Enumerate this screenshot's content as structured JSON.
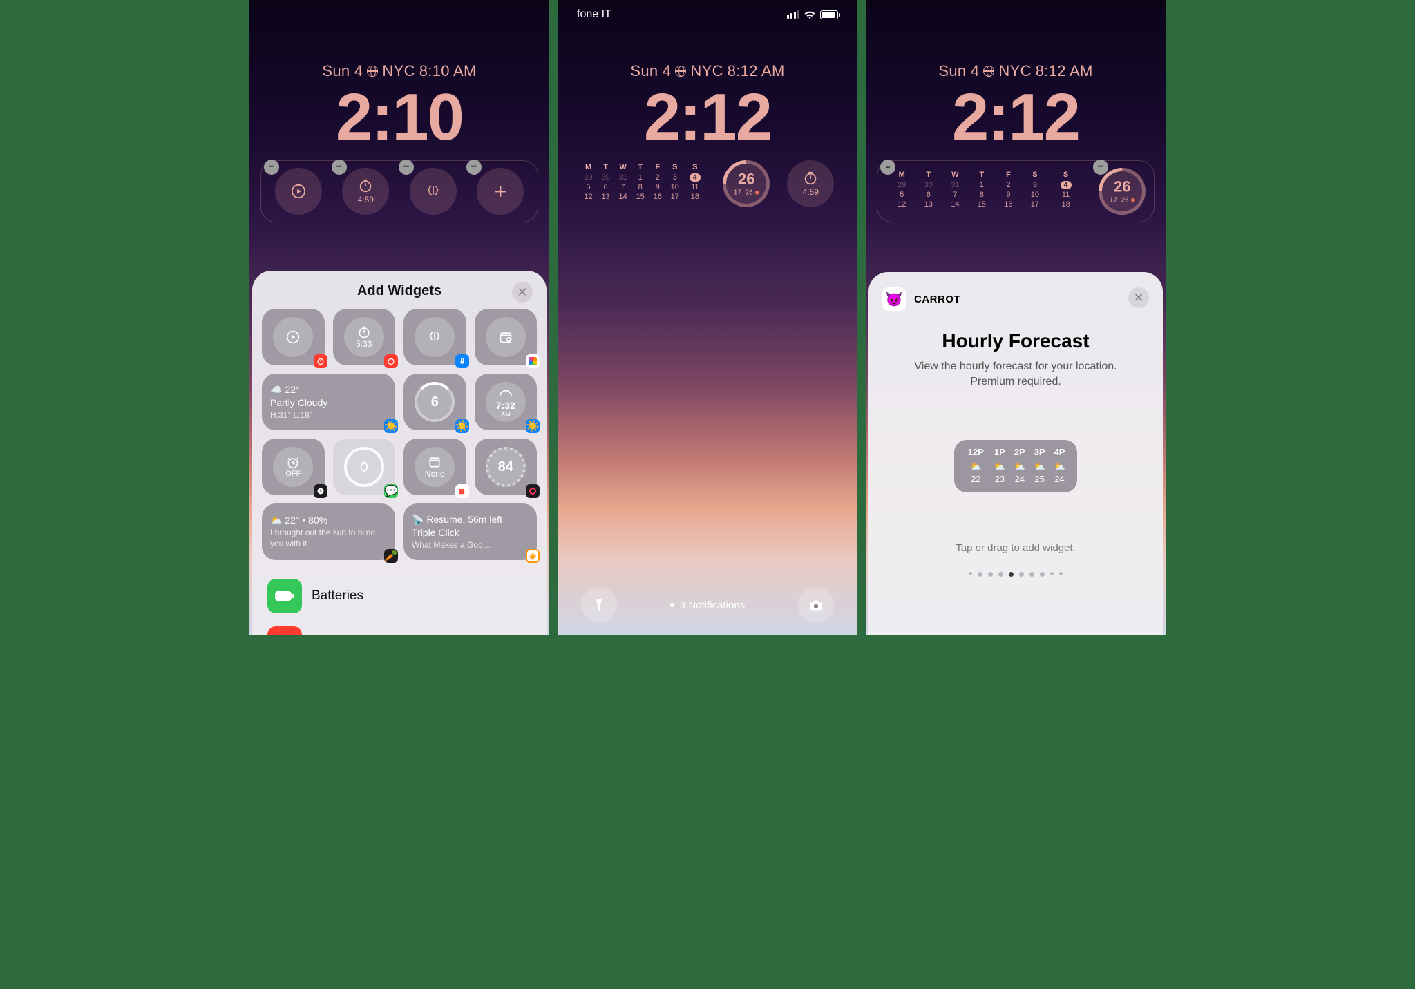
{
  "left": {
    "date": "Sun 4",
    "city": "NYC",
    "sub_time": "8:10 AM",
    "time": "2:10",
    "slots": {
      "timer": "4:59",
      "plus": "+"
    },
    "sheet": {
      "title": "Add Widgets",
      "suggestions": {
        "timer": "5:33",
        "weather": {
          "temp": "22°",
          "cond": "Partly Cloudy",
          "hl": "H:31° L:18°"
        },
        "uv": "6",
        "sunrise": "7:32",
        "sunrise_ampm": "AM",
        "alarm": "OFF",
        "cal_none": "None",
        "fitness": "84",
        "carrot_line1": "22°  •  80%",
        "carrot_line2": "I brought out the sun to blind you with it.",
        "overcast_l1": "Resume, 56m left",
        "overcast_l2": "Triple Click",
        "overcast_l3": "What Makes a Goo…"
      },
      "list_batteries": "Batteries"
    }
  },
  "center": {
    "carrier": "fone IT",
    "date": "Sun 4",
    "city": "NYC",
    "sub_time": "8:12 AM",
    "time": "2:12",
    "ring_big": "26",
    "ring_small_l": "17",
    "ring_small_r": "26",
    "timer": "4:59",
    "notifications": "3 Notifications",
    "calendar": {
      "dow": [
        "M",
        "T",
        "W",
        "T",
        "F",
        "S",
        "S"
      ],
      "rows": [
        [
          "29",
          "30",
          "31",
          "1",
          "2",
          "3",
          "4"
        ],
        [
          "5",
          "6",
          "7",
          "8",
          "9",
          "10",
          "11"
        ],
        [
          "12",
          "13",
          "14",
          "15",
          "16",
          "17",
          "18"
        ]
      ],
      "dim": [
        0,
        1,
        2
      ],
      "today": [
        0,
        6
      ]
    }
  },
  "right": {
    "date": "Sun 4",
    "city": "NYC",
    "sub_time": "8:12 AM",
    "time": "2:12",
    "ring_big": "26",
    "ring_small_l": "17",
    "ring_small_r": "26",
    "app": "CARROT",
    "title": "Hourly Forecast",
    "desc1": "View the hourly forecast for your location.",
    "desc2": "Premium required.",
    "hint": "Tap or drag to add widget.",
    "hourly": {
      "labels": [
        "12P",
        "1P",
        "2P",
        "3P",
        "4P"
      ],
      "temps": [
        "22",
        "23",
        "24",
        "25",
        "24"
      ]
    },
    "pager_index": 4,
    "pager_count": 10
  }
}
